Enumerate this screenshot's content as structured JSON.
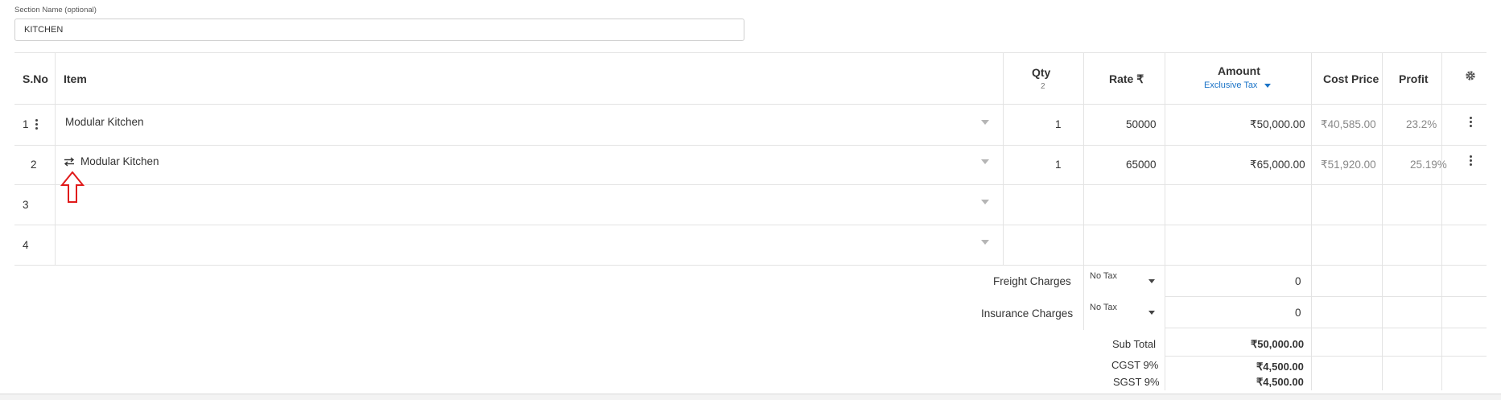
{
  "section": {
    "label": "Section Name (optional)",
    "value": "KITCHEN"
  },
  "table": {
    "headers": {
      "sno": "S.No",
      "item": "Item",
      "qty": "Qty",
      "qty_total": "2",
      "rate": "Rate ₹",
      "amount": "Amount",
      "tax_mode": "Exclusive Tax",
      "cost_price": "Cost Price",
      "profit": "Profit"
    },
    "rows": [
      {
        "sno": "1",
        "item": "Modular Kitchen",
        "qty": "1",
        "rate": "50000",
        "amount": "₹50,000.00",
        "cost_price": "₹40,585.00",
        "profit": "23.2%"
      },
      {
        "sno": "2",
        "item": "Modular Kitchen",
        "qty": "1",
        "rate": "65000",
        "amount": "₹65,000.00",
        "cost_price": "₹51,920.00",
        "profit": "25.19%"
      },
      {
        "sno": "3",
        "item": "",
        "qty": "",
        "rate": "",
        "amount": "",
        "cost_price": "",
        "profit": ""
      },
      {
        "sno": "4",
        "item": "",
        "qty": "",
        "rate": "",
        "amount": "",
        "cost_price": "",
        "profit": ""
      }
    ]
  },
  "charges": [
    {
      "label": "Freight Charges",
      "tax": "No Tax",
      "value": "0"
    },
    {
      "label": "Insurance Charges",
      "tax": "No Tax",
      "value": "0"
    }
  ],
  "totals": [
    {
      "label": "Sub Total",
      "value": "₹50,000.00"
    },
    {
      "label": "CGST 9%",
      "value": "₹4,500.00"
    },
    {
      "label": "SGST 9%",
      "value": "₹4,500.00"
    }
  ],
  "icons": {
    "settings": "gear-icon",
    "row_menu": "vertical-dots-icon",
    "swap": "swap-arrows-icon",
    "annotation": "up-arrow-annotation"
  },
  "colors": {
    "accent": "#1a73c7",
    "annotation": "#e01b1b",
    "border": "#e3e3e3"
  }
}
